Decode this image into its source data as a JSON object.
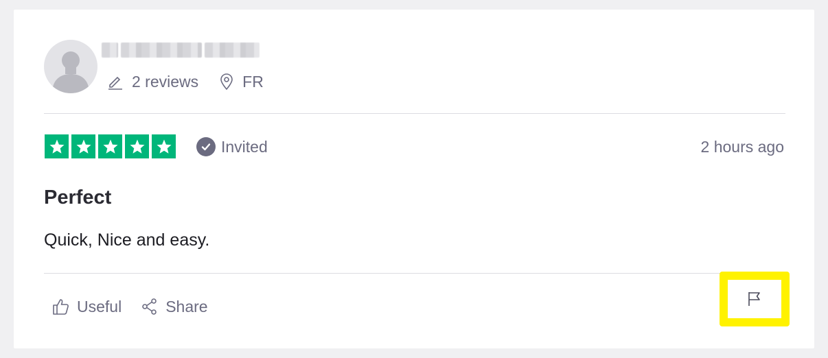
{
  "review": {
    "reviewer": {
      "name_redacted": true,
      "reviews_count_label": "2 reviews",
      "country": "FR"
    },
    "rating": 5,
    "rating_max": 5,
    "invited_label": "Invited",
    "timestamp": "2 hours ago",
    "title": "Perfect",
    "body": "Quick, Nice and easy.",
    "actions": {
      "useful_label": "Useful",
      "share_label": "Share"
    }
  },
  "colors": {
    "star_green": "#00b67a",
    "muted_text": "#6b6b80",
    "highlight": "#fff200"
  },
  "icons": [
    "avatar-silhouette-icon",
    "pencil-icon",
    "location-pin-icon",
    "star-icon",
    "check-circle-icon",
    "thumbs-up-icon",
    "share-icon",
    "flag-icon"
  ]
}
